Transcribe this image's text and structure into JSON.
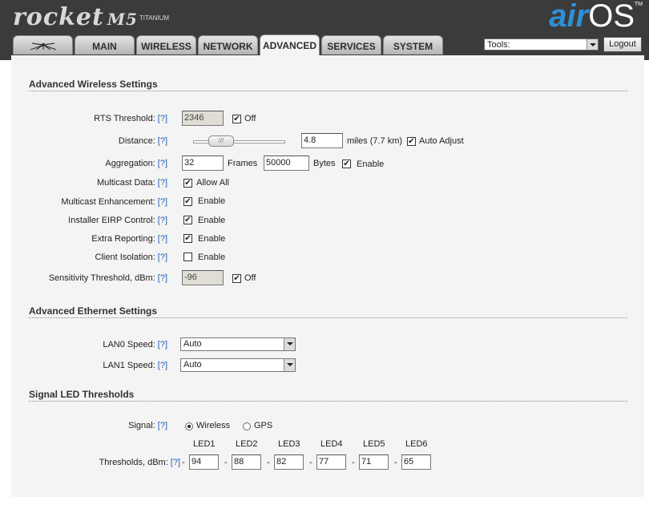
{
  "header": {
    "product_logo": "rocket",
    "product_model": "M5",
    "product_variant": "TITANIUM",
    "brand_air": "air",
    "brand_os": "OS",
    "brand_tm": "TM"
  },
  "tabs": [
    {
      "label": "",
      "icon": "ubnt-logo-icon"
    },
    {
      "label": "MAIN"
    },
    {
      "label": "WIRELESS"
    },
    {
      "label": "NETWORK"
    },
    {
      "label": "ADVANCED"
    },
    {
      "label": "SERVICES"
    },
    {
      "label": "SYSTEM"
    }
  ],
  "tools": {
    "selected": "Tools:"
  },
  "logout_label": "Logout",
  "help": "[?]",
  "wireless": {
    "title": "Advanced Wireless Settings",
    "rts": {
      "label": "RTS Threshold:",
      "value": "2346",
      "off_label": "Off"
    },
    "distance": {
      "label": "Distance:",
      "value": "4.8",
      "unit": "miles (7.7 km)",
      "auto_label": "Auto Adjust"
    },
    "aggregation": {
      "label": "Aggregation:",
      "frames_value": "32",
      "frames_unit": "Frames",
      "bytes_value": "50000",
      "bytes_unit": "Bytes",
      "enable_label": "Enable"
    },
    "multicast_data": {
      "label": "Multicast Data:",
      "option": "Allow All"
    },
    "multicast_enh": {
      "label": "Multicast Enhancement:",
      "option": "Enable"
    },
    "eirp": {
      "label": "Installer EIRP Control:",
      "option": "Enable"
    },
    "extra_reporting": {
      "label": "Extra Reporting:",
      "option": "Enable"
    },
    "client_isolation": {
      "label": "Client Isolation:",
      "option": "Enable"
    },
    "sensitivity": {
      "label": "Sensitivity Threshold, dBm:",
      "value": "-96",
      "off_label": "Off"
    }
  },
  "ethernet": {
    "title": "Advanced Ethernet Settings",
    "lan0": {
      "label": "LAN0 Speed:",
      "value": "Auto"
    },
    "lan1": {
      "label": "LAN1 Speed:",
      "value": "Auto"
    }
  },
  "led": {
    "title": "Signal LED Thresholds",
    "signal": {
      "label": "Signal:",
      "wireless": "Wireless",
      "gps": "GPS"
    },
    "headers": [
      "LED1",
      "LED2",
      "LED3",
      "LED4",
      "LED5",
      "LED6"
    ],
    "thresholds_label": "Thresholds, dBm:",
    "dash": "-",
    "values": [
      "94",
      "88",
      "82",
      "77",
      "71",
      "65"
    ]
  },
  "check_mark": "✔"
}
